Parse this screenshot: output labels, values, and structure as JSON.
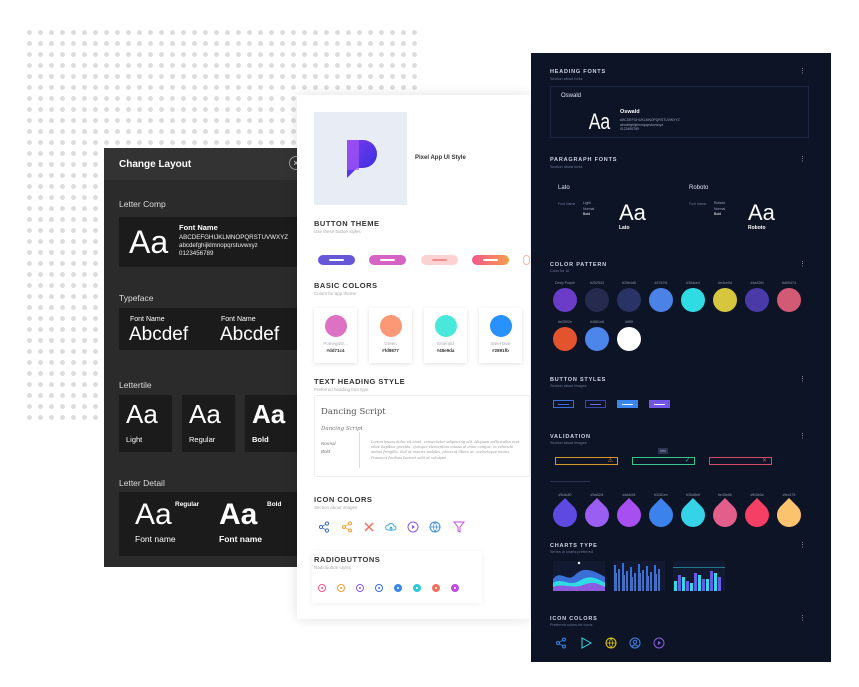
{
  "left_panel": {
    "title": "Change Layout",
    "close": "×",
    "letter_comp": {
      "title": "Letter Comp",
      "glyph": "Aa",
      "font_label": "Font Name",
      "upper": "ABCDEFGHIJKLMNOPQRSTUVWXYZ",
      "lower": "abcdefghijklmnopqrstuvwxyz",
      "digits": "0123456789"
    },
    "typeface": {
      "title": "Typeface",
      "items": [
        {
          "label": "Font Name",
          "sample": "Abcdef"
        },
        {
          "label": "Font Name",
          "sample": "Abcdef"
        }
      ]
    },
    "lettertile": {
      "title": "Lettertile",
      "glyph": "Aa",
      "items": [
        "Light",
        "Regular",
        "Bold"
      ]
    },
    "letter_detail": {
      "title": "Letter Detail",
      "glyph": "Aa",
      "items": [
        {
          "weight": "Regular",
          "label": "Font name"
        },
        {
          "weight": "Bold",
          "label": "Font name"
        }
      ]
    }
  },
  "middle_panel": {
    "app_title": "Pixel App UI Style",
    "button_theme": {
      "title": "BUTTON THEME",
      "subtitle": "Use these button styles"
    },
    "basic_colors": {
      "title": "BASIC COLORS",
      "subtitle": "Colors for app theme",
      "items": [
        {
          "name": "Pomegran...",
          "hex": "#dd71c4",
          "color": "#dd71c4"
        },
        {
          "name": "Green",
          "hex": "#fd9877",
          "color": "#fd9877"
        },
        {
          "name": "Emerald",
          "hex": "#48e9da",
          "color": "#48e9da"
        },
        {
          "name": "Steel blue",
          "hex": "#2891fb",
          "color": "#2891fb"
        }
      ]
    },
    "text_heading": {
      "title": "TEXT HEADING STYLE",
      "subtitle": "Preferred heading font type",
      "font": "Dancing Script",
      "font_small": "Dancing Script",
      "weights": [
        "Normal",
        "Bold"
      ],
      "paragraph": "Lorem ipsum dolor sit amet, consectetur adipiscing elit. Aliquam sollicitudin erat vitae dapibus gravida. Quisque elementum massa id enim congue, in vehicula metus fringilla. Sed at mauris sodales, placerat libero at, scelerisque metus. Praesent facilisis laoreet velit at volutpat."
    },
    "icon_colors": {
      "title": "ICON COLORS",
      "subtitle": "Section about images"
    },
    "radiobuttons": {
      "title": "RADIOBUTTONS",
      "subtitle": "Radiobutton styles"
    }
  },
  "right_panel": {
    "heading_fonts": {
      "title": "HEADING FONTS",
      "subtitle": "Section about fonts",
      "font_name": "Oswald",
      "glyph": "Aa",
      "name_label": "Oswald",
      "upper": "ABCDEFGHIJKLMNOPQRSTUVWXYZ",
      "lower": "abcdefghijklmnopqrstuvwxyz",
      "digits": "0123456789"
    },
    "paragraph_fonts": {
      "title": "PARAGRAPH FONTS",
      "subtitle": "Section about fonts",
      "fonts": [
        {
          "name": "Lato",
          "label": "Font Name",
          "weights": [
            "Light",
            "Normal",
            "Bold"
          ],
          "glyph": "Aa",
          "caption": "Lato"
        },
        {
          "name": "Roboto",
          "label": "Font Name",
          "weights": [
            "Roboto",
            "Normal",
            "Bold"
          ],
          "glyph": "Aa",
          "caption": "Roboto"
        }
      ]
    },
    "color_pattern": {
      "title": "COLOR PATTERN",
      "subtitle": "Color for UI",
      "items": [
        {
          "hex": "Deep Purple",
          "color": "#6a3cc8"
        },
        {
          "hex": "#252543",
          "color": "#252a4e"
        },
        {
          "hex": "#25b4d6",
          "color": "#2a3366"
        },
        {
          "hex": "#4787f4",
          "color": "#4a82e8"
        },
        {
          "hex": "#30dce4",
          "color": "#30dce4"
        },
        {
          "hex": "#e4ce0d",
          "color": "#d6c63e"
        },
        {
          "hex": "#4a32fd",
          "color": "#4a3aa8"
        },
        {
          "hex": "#d05474",
          "color": "#d35a74"
        },
        {
          "hex": "#e2502e",
          "color": "#e3532e"
        },
        {
          "hex": "#4881e8",
          "color": "#4d86ea"
        },
        {
          "hex": "#ffffff",
          "color": "#ffffff"
        }
      ]
    },
    "button_styles": {
      "title": "BUTTON STYLES",
      "subtitle": "Section about images"
    },
    "validation": {
      "title": "VALIDATION",
      "subtitle": "Section about images",
      "tooltip": "###"
    },
    "drops": {
      "items": [
        {
          "hex": "#5d4df0",
          "color": "#5e4ae3"
        },
        {
          "hex": "#9a62f4",
          "color": "#9a5ff2"
        },
        {
          "hex": "#a64bf4",
          "color": "#a74ff0"
        },
        {
          "hex": "#3281ee",
          "color": "#3b82ec"
        },
        {
          "hex": "#30d8e6",
          "color": "#36d2e8"
        },
        {
          "hex": "#e45e8b",
          "color": "#e45e8b"
        },
        {
          "hex": "#fb3e6a",
          "color": "#f53f64"
        },
        {
          "hex": "#fec475",
          "color": "#fcc36e"
        }
      ]
    },
    "charts_type": {
      "title": "CHARTS TYPE",
      "subtitle": "Series of charts preferred"
    },
    "icon_colors": {
      "title": "ICON COLORS",
      "subtitle": "Preferred colors for icons"
    }
  },
  "colors": {
    "left_bg": "#2b2b2b",
    "right_bg": "#0d1425",
    "accent_purple": "#6a3cc8"
  }
}
